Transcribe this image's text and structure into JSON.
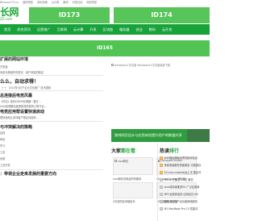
{
  "topbar": {
    "items": [
      "Ntraces173.cn",
      "源码导航",
      "资讯攻略",
      "云计算",
      "数码",
      "问答社区",
      "网站导航"
    ]
  },
  "logo": {
    "main": "长网",
    "sub": "ZZ.com"
  },
  "ads": {
    "left_label": "ID173",
    "right_label": "ID174",
    "color": "#57c55a"
  },
  "nav": {
    "color": "#17a23a",
    "items": [
      "首页",
      "综合资讯",
      "运营推广",
      "互联网",
      "云计算",
      "开发",
      "区块链",
      "服务器",
      "创业",
      "数码",
      "云开发"
    ]
  },
  "banner": {
    "label": "ID165",
    "color": "#51c453"
  },
  "image_placeholder": {
    "alt": "windows11中文版 Windows11中文版免费下载"
  },
  "left_column": {
    "heading1": "扩展的网站环境",
    "line1": "开发者",
    "line2": "系统长期维护的首页 · 用户体验的稳定",
    "heading2": "么么，自动求得！",
    "line3": "（一） 2010年4月于企业文化推广·技术更新",
    "heading3": "总连接后电竞风暴",
    "line4": "《内存》面向DRAM存储器一直在…",
    "line5": "Intel处理器全面更新提供新的计算平台…",
    "heading4": "电竞应用帮设置快速启动",
    "line6": "更快速地让游戏客户端启动起来…",
    "heading5": "与冲突解决的策略",
    "line7": "应用",
    "line8": "网站",
    "line9": "学习",
    "line10": "工具",
    "line11": "资源",
    "line12": "工具开发",
    "heading6": "：带领企业走来发展的重要方向"
  },
  "feature": {
    "title": "独特网页设计与应用体验提升用户的数据共享"
  },
  "recommend": {
    "heading_prefix": "大家",
    "heading_accent": "都在看",
    "items": [
      {
        "caption": "vivo新机亮相会所有服务",
        "image_alt": "vivo新机"
      },
      {
        "caption": "Windows Insider 移动版",
        "image_alt": "Windows Insider"
      },
      {
        "caption": "2月初的区块链技术"
      },
      {
        "caption": "10月视频互动平台"
      }
    ]
  },
  "hot": {
    "heading_prefix": "热读",
    "heading_accent": "排行",
    "items": [
      "WiFi路由器最优秀性能评估实",
      "传统家装都在快速普及 才能提高",
      "SiCmos mobileb运上手 推出开",
      "MSGs 已通过 2.5亿 服务",
      "vivo将持续推进5G 广泛应用新",
      "MPC运营商加持 应用高达100",
      "最新消息国产全功能网络服务",
      "M2 MacBook Pro 13 性能评"
    ]
  }
}
